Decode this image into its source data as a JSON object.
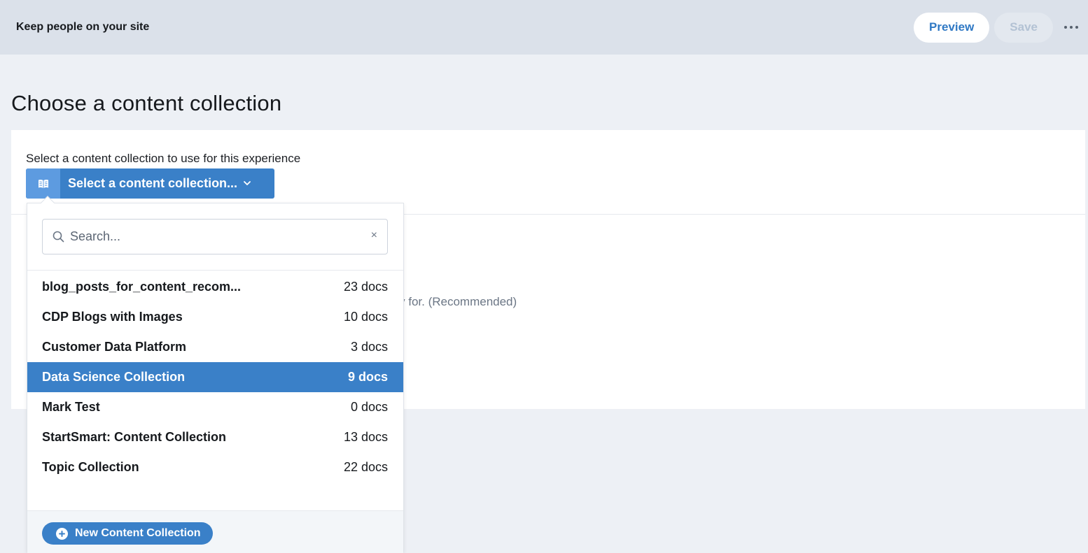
{
  "header": {
    "title": "Keep people on your site",
    "preview_label": "Preview",
    "save_label": "Save"
  },
  "page": {
    "title": "Choose a content collection"
  },
  "content_section": {
    "subtitle": "Select a content collection to use for this experience",
    "select_label": "Select a content collection...",
    "partial_text": "y for. (Recommended)"
  },
  "dropdown": {
    "search_placeholder": "Search...",
    "clear_symbol": "×",
    "items": [
      {
        "name": "blog_posts_for_content_recom...",
        "count": "23 docs"
      },
      {
        "name": "CDP Blogs with Images",
        "count": "10 docs"
      },
      {
        "name": "Customer Data Platform",
        "count": "3 docs"
      },
      {
        "name": "Data Science Collection",
        "count": "9 docs",
        "selected": true
      },
      {
        "name": "Mark Test",
        "count": "0 docs"
      },
      {
        "name": "StartSmart: Content Collection",
        "count": "13 docs"
      },
      {
        "name": "Topic Collection",
        "count": "22 docs"
      }
    ],
    "new_label": "New Content Collection"
  },
  "colors": {
    "accent": "#3a80c8",
    "accent_light": "#5d9be0",
    "topbar": "#dbe1ea",
    "background": "#edf0f5"
  },
  "icons": {
    "select": "book-icon",
    "chevron": "chevron-down-icon",
    "search": "search-icon",
    "clear": "close-icon",
    "new": "plus-circle-icon",
    "more": "more-icon"
  }
}
